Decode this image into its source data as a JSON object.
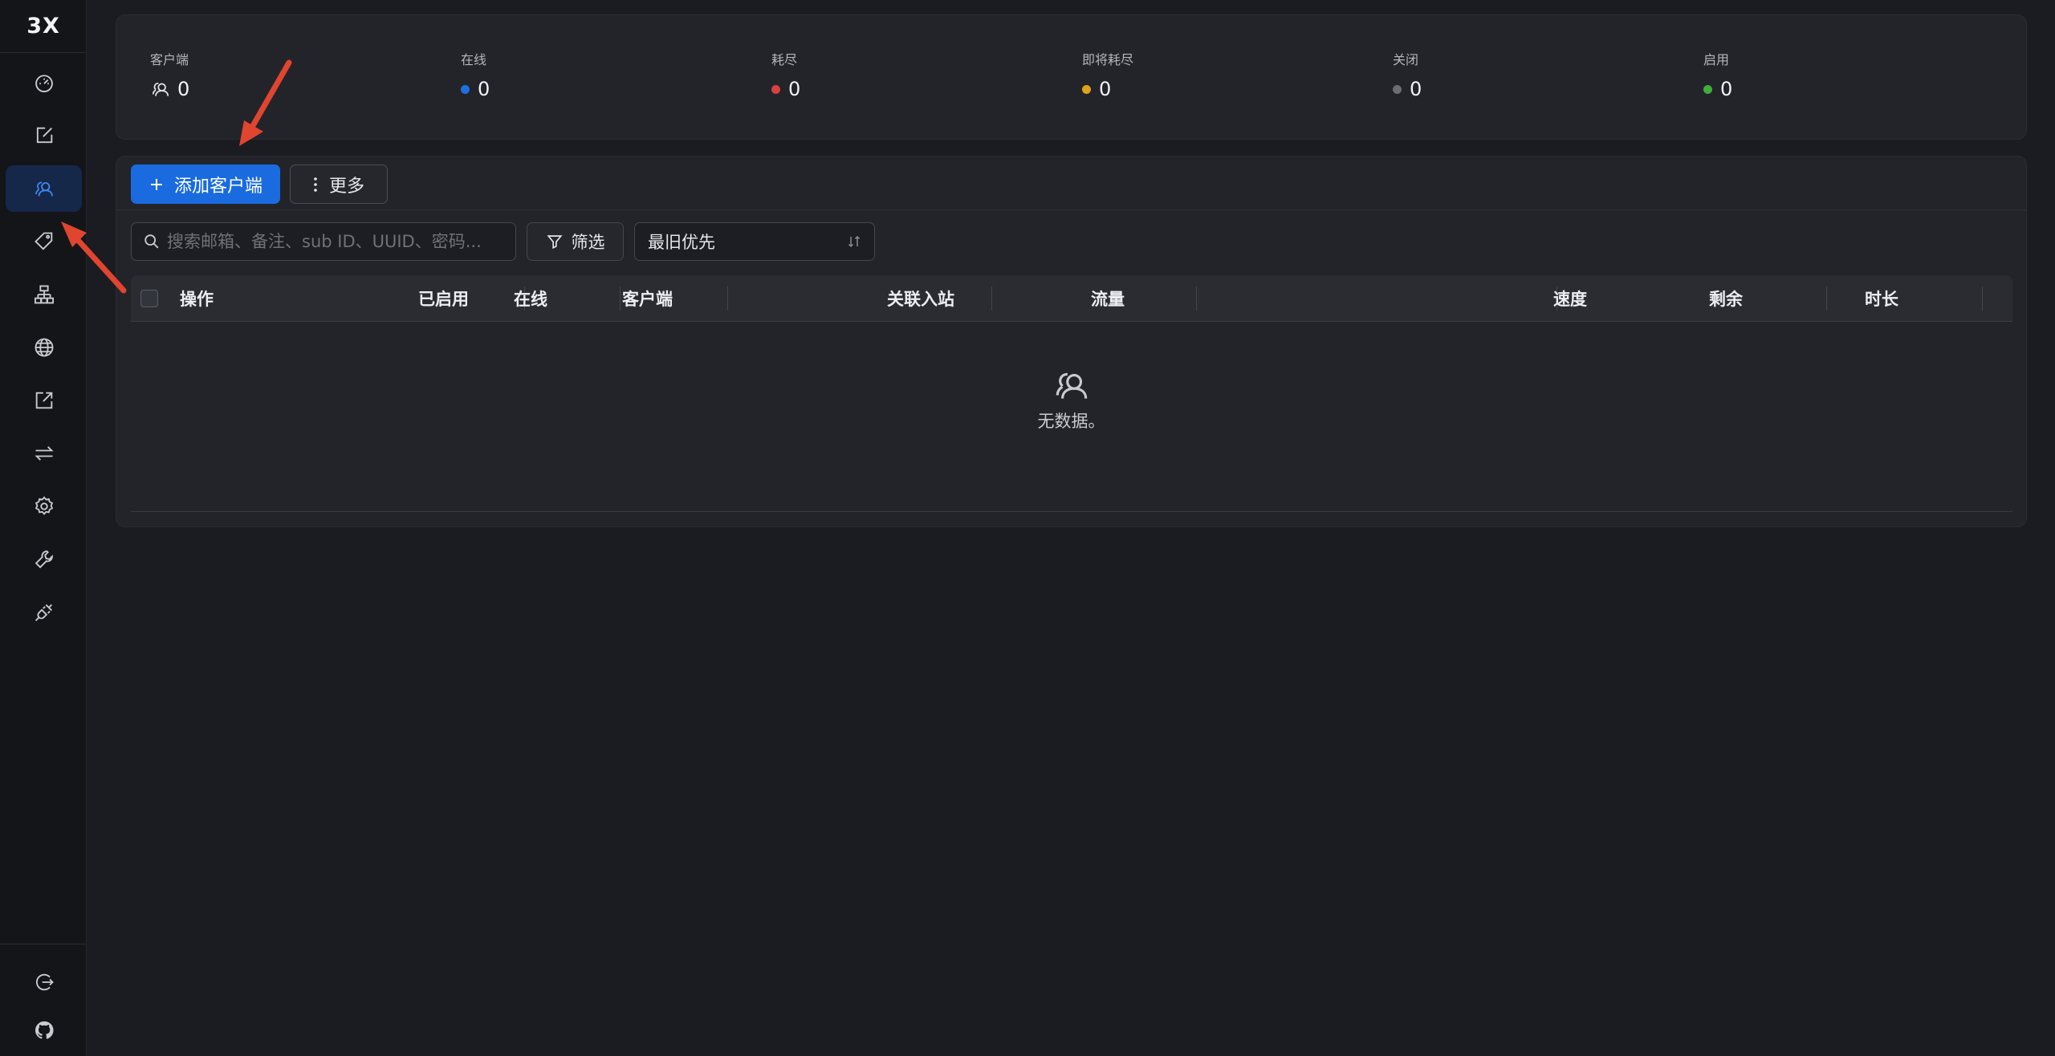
{
  "brand": "3X",
  "sidebar": {
    "items": [
      {
        "name": "dashboard",
        "icon": "speedometer-icon",
        "active": false
      },
      {
        "name": "inbounds",
        "icon": "edit-icon",
        "active": false
      },
      {
        "name": "clients",
        "icon": "users-icon",
        "active": true
      },
      {
        "name": "tags",
        "icon": "tag-icon",
        "active": false
      },
      {
        "name": "nodes",
        "icon": "cluster-icon",
        "active": false
      },
      {
        "name": "routing",
        "icon": "globe-icon",
        "active": false
      },
      {
        "name": "outbounds",
        "icon": "export-icon",
        "active": false
      },
      {
        "name": "transfer",
        "icon": "swap-icon",
        "active": false
      },
      {
        "name": "settings",
        "icon": "gear-icon",
        "active": false
      },
      {
        "name": "tools",
        "icon": "wrench-icon",
        "active": false
      },
      {
        "name": "api",
        "icon": "plug-icon",
        "active": false
      }
    ],
    "bottom": [
      {
        "name": "logout",
        "icon": "logout-icon"
      },
      {
        "name": "github",
        "icon": "github-icon"
      }
    ]
  },
  "stats": {
    "clients": {
      "label": "客户端",
      "value": "0"
    },
    "online": {
      "label": "在线",
      "value": "0",
      "color": "#1f6fe0"
    },
    "depleted": {
      "label": "耗尽",
      "value": "0",
      "color": "#d9413f"
    },
    "expiring": {
      "label": "即将耗尽",
      "value": "0",
      "color": "#e0a21c"
    },
    "disabled": {
      "label": "关闭",
      "value": "0",
      "color": "#6b6d75"
    },
    "enabled": {
      "label": "启用",
      "value": "0",
      "color": "#3fae3a"
    }
  },
  "toolbar": {
    "add_label": "添加客户端",
    "more_label": "更多"
  },
  "filters": {
    "search_placeholder": "搜索邮箱、备注、sub ID、UUID、密码...",
    "filter_label": "筛选",
    "sort_value": "最旧优先"
  },
  "table": {
    "columns": [
      "操作",
      "已启用",
      "在线",
      "客户端",
      "关联入站",
      "流量",
      "速度",
      "剩余",
      "时长"
    ],
    "rows": [],
    "empty_text": "无数据。"
  },
  "colors": {
    "accent": "#1a6be0",
    "annotation": "#e0452f"
  }
}
